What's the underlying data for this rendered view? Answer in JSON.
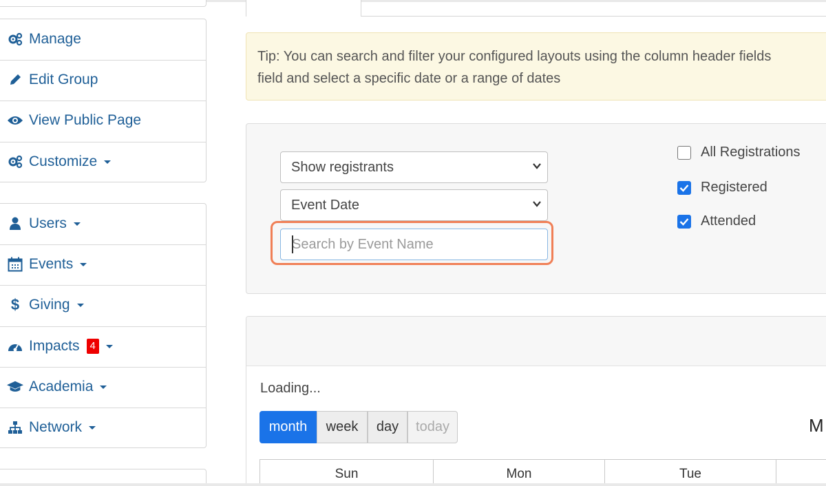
{
  "sidebar": {
    "group1": [
      {
        "label": "Manage",
        "icon": "gears-icon"
      },
      {
        "label": "Edit Group",
        "icon": "pencil-icon"
      },
      {
        "label": "View Public Page",
        "icon": "eye-icon"
      },
      {
        "label": "Customize",
        "icon": "gears-icon"
      }
    ],
    "group2": [
      {
        "label": "Users",
        "icon": "user-icon"
      },
      {
        "label": "Events",
        "icon": "calendar-icon"
      },
      {
        "label": "Giving",
        "icon": "dollar-icon"
      },
      {
        "label": "Impacts",
        "icon": "dashboard-icon",
        "badge": "4"
      },
      {
        "label": "Academia",
        "icon": "graduation-cap-icon"
      },
      {
        "label": "Network",
        "icon": "sitemap-icon"
      }
    ]
  },
  "tip": {
    "line1": "Tip: You can search and filter your configured layouts using the column header fields",
    "line2": "field and select a specific date or a range of dates"
  },
  "filters": {
    "show_select": "Show registrants",
    "date_select": "Event Date",
    "search_placeholder": "Search by Event Name",
    "checkboxes": [
      {
        "label": "All Registrations",
        "checked": false
      },
      {
        "label": "Registered",
        "checked": true
      },
      {
        "label": "Attended",
        "checked": true
      }
    ]
  },
  "calendar": {
    "loading": "Loading...",
    "views": [
      "month",
      "week",
      "day",
      "today"
    ],
    "active_view": "month",
    "title_partial": "M",
    "days": [
      "Sun",
      "Mon",
      "Tue"
    ]
  },
  "colors": {
    "link": "#1f5f97",
    "accent": "#1a73e8",
    "badge": "#ee0000",
    "tip_bg": "#fcf8e3",
    "highlight": "#f07f56"
  }
}
